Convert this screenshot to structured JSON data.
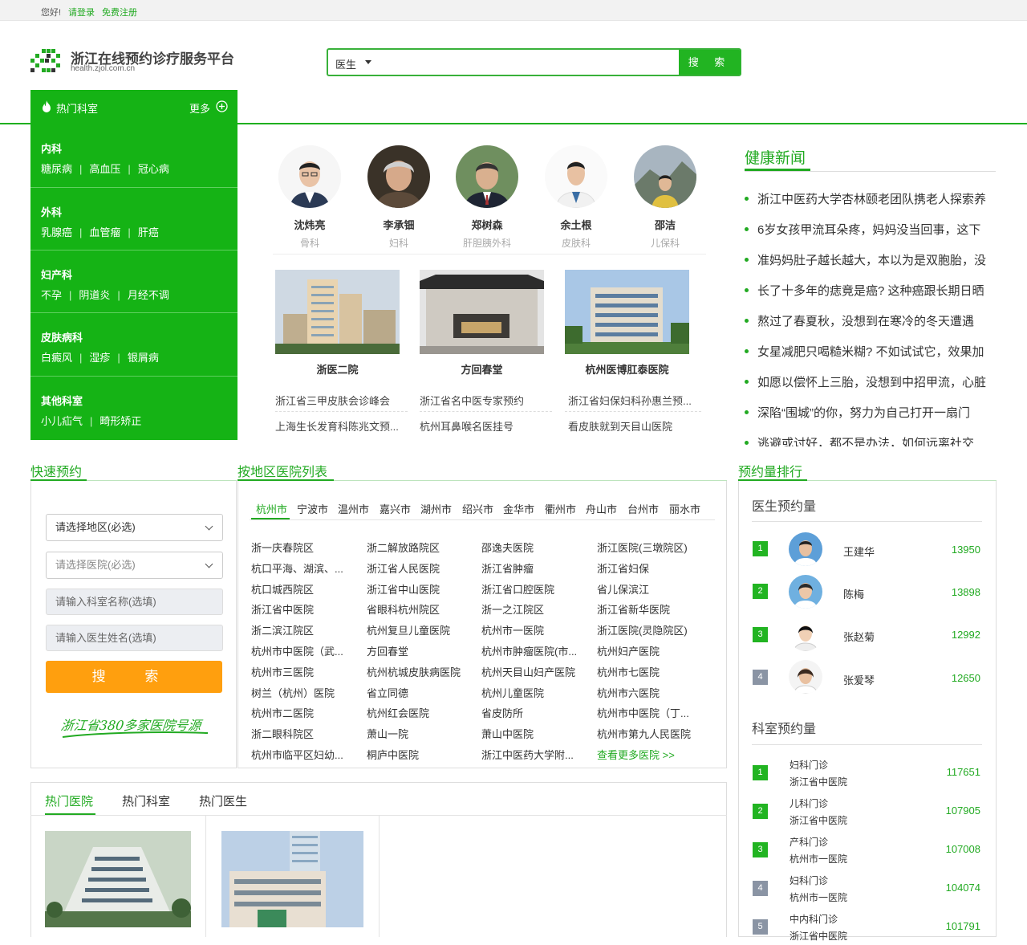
{
  "topbar": {
    "greeting": "您好!",
    "login": "请登录",
    "register": "免费注册"
  },
  "logo": {
    "title": "浙江在线预约诊疗服务平台",
    "url": "health.zjol.com.cn"
  },
  "search": {
    "type": "医生",
    "button": "搜 索"
  },
  "hot_dept": {
    "title": "热门科室",
    "more": "更多",
    "sections": [
      {
        "title": "内科",
        "items": [
          "糖尿病",
          "高血压",
          "冠心病"
        ]
      },
      {
        "title": "外科",
        "items": [
          "乳腺癌",
          "血管瘤",
          "肝癌"
        ]
      },
      {
        "title": "妇产科",
        "items": [
          "不孕",
          "阴道炎",
          "月经不调"
        ]
      },
      {
        "title": "皮肤病科",
        "items": [
          "白癜风",
          "湿疹",
          "银屑病"
        ]
      },
      {
        "title": "其他科室",
        "items": [
          "小儿疝气",
          "畸形矫正"
        ]
      }
    ]
  },
  "doctors": [
    {
      "name": "沈炜亮",
      "dept": "骨科"
    },
    {
      "name": "李承钿",
      "dept": "妇科"
    },
    {
      "name": "郑树森",
      "dept": "肝胆胰外科"
    },
    {
      "name": "余土根",
      "dept": "皮肤科"
    },
    {
      "name": "邵洁",
      "dept": "儿保科"
    }
  ],
  "hospitals_feature": [
    {
      "name": "浙医二院",
      "links": [
        "浙江省三甲皮肤会诊峰会",
        "上海生长发育科陈兆文预..."
      ]
    },
    {
      "name": "方回春堂",
      "links": [
        "浙江省名中医专家预约",
        "杭州耳鼻喉名医挂号"
      ]
    },
    {
      "name": "杭州医博肛泰医院",
      "links": [
        "浙江省妇保妇科孙惠兰预...",
        "看皮肤就到天目山医院"
      ]
    }
  ],
  "news": {
    "title": "健康新闻",
    "items": [
      "浙江中医药大学杏林颐老团队携老人探索养",
      "6岁女孩甲流耳朵疼，妈妈没当回事，这下",
      "准妈妈肚子越长越大，本以为是双胞胎，没",
      "长了十多年的痣竟是癌? 这种癌跟长期日晒",
      "熬过了春夏秋，没想到在寒冷的冬天遭遇",
      "女星减肥只喝糙米糊? 不如试试它，效果加",
      "如愿以偿怀上三胎，没想到中招甲流，心脏",
      "深陷“围城”的你，努力为自己打开一扇门",
      "逃避或讨好，都不是办法，如何远离社交"
    ]
  },
  "quick": {
    "title": "快速预约",
    "region": "请选择地区(必选)",
    "hospital": "请选择医院(必选)",
    "dept_ph": "请输入科室名称(选填)",
    "doctor_ph": "请输入医生姓名(选填)",
    "search": "搜 索",
    "slogan": "浙江省380多家医院号源"
  },
  "hlist": {
    "title": "按地区医院列表",
    "cities": [
      "杭州市",
      "宁波市",
      "温州市",
      "嘉兴市",
      "湖州市",
      "绍兴市",
      "金华市",
      "衢州市",
      "舟山市",
      "台州市",
      "丽水市"
    ],
    "rows": [
      [
        "浙一庆春院区",
        "浙二解放路院区",
        "邵逸夫医院",
        "浙江医院(三墩院区)"
      ],
      [
        "杭口平海、湖滨、...",
        "浙江省人民医院",
        "浙江省肿瘤",
        "浙江省妇保"
      ],
      [
        "杭口城西院区",
        "浙江省中山医院",
        "浙江省口腔医院",
        "省儿保滨江"
      ],
      [
        "浙江省中医院",
        "省眼科杭州院区",
        "浙一之江院区",
        "浙江省新华医院"
      ],
      [
        "浙二滨江院区",
        "杭州复旦儿童医院",
        "杭州市一医院",
        "浙江医院(灵隐院区)"
      ],
      [
        "杭州市中医院（武...",
        "方回春堂",
        "杭州市肿瘤医院(市...",
        "杭州妇产医院"
      ],
      [
        "杭州市三医院",
        "杭州杭城皮肤病医院",
        "杭州天目山妇产医院",
        "杭州市七医院"
      ],
      [
        "树兰（杭州）医院",
        "省立同德",
        "杭州儿童医院",
        "杭州市六医院"
      ],
      [
        "杭州市二医院",
        "杭州红会医院",
        "省皮防所",
        "杭州市中医院（丁..."
      ],
      [
        "浙二眼科院区",
        "萧山一院",
        "萧山中医院",
        "杭州市第九人民医院"
      ],
      [
        "杭州市临平区妇幼...",
        "桐庐中医院",
        "浙江中医药大学附...",
        "查看更多医院 >>"
      ]
    ]
  },
  "rank": {
    "title": "预约量排行",
    "doc_title": "医生预约量",
    "dept_title": "科室预约量",
    "doctors": [
      {
        "rank": "1",
        "name": "王建华",
        "count": "13950"
      },
      {
        "rank": "2",
        "name": "陈梅",
        "count": "13898"
      },
      {
        "rank": "3",
        "name": "张赵菊",
        "count": "12992"
      },
      {
        "rank": "4",
        "name": "张爱琴",
        "count": "12650"
      }
    ],
    "depts": [
      {
        "rank": "1",
        "dept": "妇科门诊",
        "hosp": "浙江省中医院",
        "count": "117651"
      },
      {
        "rank": "2",
        "dept": "儿科门诊",
        "hosp": "浙江省中医院",
        "count": "107905"
      },
      {
        "rank": "3",
        "dept": "产科门诊",
        "hosp": "杭州市一医院",
        "count": "107008"
      },
      {
        "rank": "4",
        "dept": "妇科门诊",
        "hosp": "杭州市一医院",
        "count": "104074"
      },
      {
        "rank": "5",
        "dept": "中内科门诊",
        "hosp": "浙江省中医院",
        "count": "101791"
      }
    ]
  },
  "hot_tabs": [
    "热门医院",
    "热门科室",
    "热门医生"
  ]
}
